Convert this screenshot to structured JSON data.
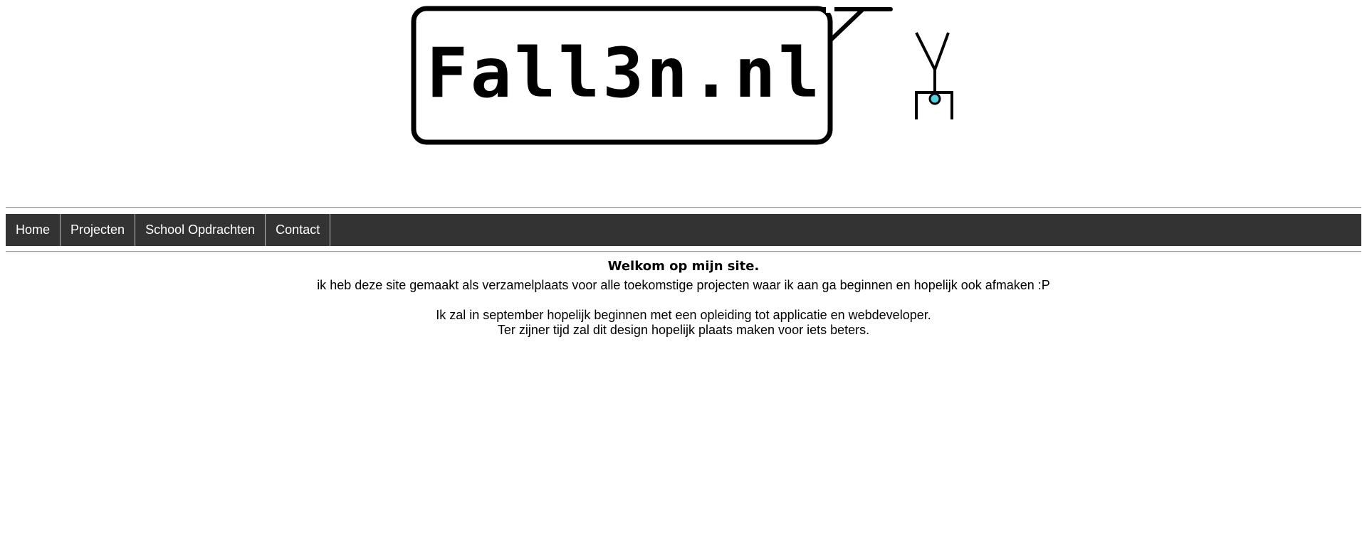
{
  "logo": {
    "text": "Fall3n.nl",
    "icon": "stick-figure-icon",
    "accent_color": "#55d0e0"
  },
  "nav": {
    "items": [
      {
        "label": "Home"
      },
      {
        "label": "Projecten"
      },
      {
        "label": "School Opdrachten"
      },
      {
        "label": "Contact"
      }
    ],
    "background_color": "#333333"
  },
  "main": {
    "heading": "Welkom op mijn site.",
    "intro": "ik heb deze site gemaakt als verzamelplaats voor alle toekomstige projecten waar ik aan ga beginnen en hopelijk ook afmaken :P",
    "line1": "Ik zal in september hopelijk beginnen met een opleiding tot applicatie en webdeveloper.",
    "line2": "Ter zijner tijd zal dit design hopelijk plaats maken voor iets beters."
  }
}
